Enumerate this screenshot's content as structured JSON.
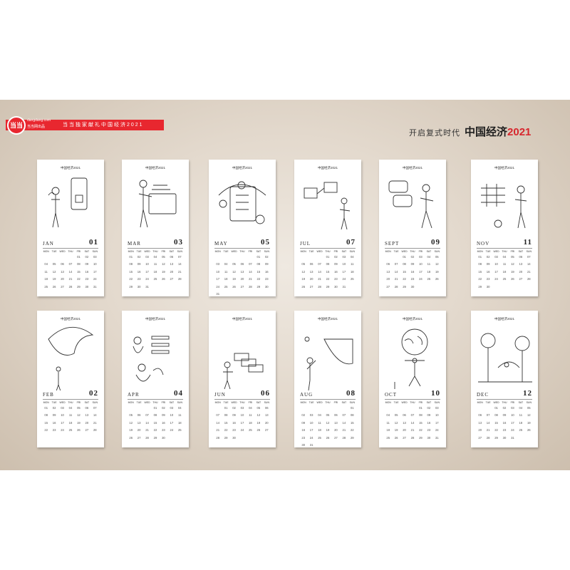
{
  "brand": {
    "logo": "当当",
    "site": "dangdang.com",
    "cn": "当当网出品",
    "slogan": "当当独家献礼中国经济2021"
  },
  "headline": {
    "sub": "开启复式时代",
    "main": "中国经济",
    "year": "2021"
  },
  "card_title": "中国经济2021",
  "weekdays": [
    "MON",
    "TUE",
    "WED",
    "THU",
    "FRI",
    "SAT",
    "SUN"
  ],
  "months": [
    {
      "name": "JAN",
      "num": "01",
      "illustration": "woman-phone-illustration",
      "days": [
        "",
        "",
        "",
        "",
        "01",
        "02",
        "03",
        "04",
        "05",
        "06",
        "07",
        "08",
        "09",
        "10",
        "11",
        "12",
        "13",
        "14",
        "15",
        "16",
        "17",
        "18",
        "19",
        "20",
        "21",
        "22",
        "23",
        "24",
        "25",
        "26",
        "27",
        "28",
        "29",
        "30",
        "31"
      ]
    },
    {
      "name": "MAR",
      "num": "03",
      "illustration": "folder-documents-illustration",
      "days": [
        "01",
        "02",
        "03",
        "04",
        "05",
        "06",
        "07",
        "08",
        "09",
        "10",
        "11",
        "12",
        "13",
        "14",
        "15",
        "16",
        "17",
        "18",
        "19",
        "20",
        "21",
        "22",
        "23",
        "24",
        "25",
        "26",
        "27",
        "28",
        "29",
        "30",
        "31"
      ]
    },
    {
      "name": "MAY",
      "num": "05",
      "illustration": "checklist-clipboard-illustration",
      "days": [
        "",
        "",
        "",
        "",
        "",
        "01",
        "02",
        "03",
        "04",
        "05",
        "06",
        "07",
        "08",
        "09",
        "10",
        "11",
        "12",
        "13",
        "14",
        "15",
        "16",
        "17",
        "18",
        "19",
        "20",
        "21",
        "22",
        "23",
        "24",
        "25",
        "26",
        "27",
        "28",
        "29",
        "30",
        "31"
      ]
    },
    {
      "name": "JUL",
      "num": "07",
      "illustration": "presentation-illustration",
      "days": [
        "",
        "",
        "",
        "01",
        "02",
        "03",
        "04",
        "05",
        "06",
        "07",
        "08",
        "09",
        "10",
        "11",
        "12",
        "13",
        "14",
        "15",
        "16",
        "17",
        "18",
        "19",
        "20",
        "21",
        "22",
        "23",
        "24",
        "25",
        "26",
        "27",
        "28",
        "29",
        "30",
        "31"
      ]
    },
    {
      "name": "SEPT",
      "num": "09",
      "illustration": "chat-bubbles-illustration",
      "days": [
        "",
        "",
        "01",
        "02",
        "03",
        "04",
        "05",
        "06",
        "07",
        "08",
        "09",
        "10",
        "11",
        "12",
        "13",
        "14",
        "15",
        "16",
        "17",
        "18",
        "19",
        "20",
        "21",
        "22",
        "23",
        "24",
        "25",
        "26",
        "27",
        "28",
        "29",
        "30"
      ]
    },
    {
      "name": "NOV",
      "num": "11",
      "illustration": "chart-analyst-illustration",
      "days": [
        "01",
        "02",
        "03",
        "04",
        "05",
        "06",
        "07",
        "08",
        "09",
        "10",
        "11",
        "12",
        "13",
        "14",
        "15",
        "16",
        "17",
        "18",
        "19",
        "20",
        "21",
        "22",
        "23",
        "24",
        "25",
        "26",
        "27",
        "28",
        "29",
        "30"
      ]
    },
    {
      "name": "FEB",
      "num": "02",
      "illustration": "moon-figure-illustration",
      "days": [
        "01",
        "02",
        "03",
        "04",
        "05",
        "06",
        "07",
        "08",
        "09",
        "10",
        "11",
        "12",
        "13",
        "14",
        "15",
        "16",
        "17",
        "18",
        "19",
        "20",
        "21",
        "22",
        "23",
        "24",
        "25",
        "26",
        "27",
        "28"
      ]
    },
    {
      "name": "APR",
      "num": "04",
      "illustration": "team-meeting-illustration",
      "days": [
        "",
        "",
        "",
        "01",
        "02",
        "03",
        "04",
        "05",
        "06",
        "07",
        "08",
        "09",
        "10",
        "11",
        "12",
        "13",
        "14",
        "15",
        "16",
        "17",
        "18",
        "19",
        "20",
        "21",
        "22",
        "23",
        "24",
        "25",
        "26",
        "27",
        "28",
        "29",
        "30"
      ]
    },
    {
      "name": "JUN",
      "num": "06",
      "illustration": "workflow-cards-illustration",
      "days": [
        "",
        "01",
        "02",
        "03",
        "04",
        "05",
        "06",
        "07",
        "08",
        "09",
        "10",
        "11",
        "12",
        "13",
        "14",
        "15",
        "16",
        "17",
        "18",
        "19",
        "20",
        "21",
        "22",
        "23",
        "24",
        "25",
        "26",
        "27",
        "28",
        "29",
        "30"
      ]
    },
    {
      "name": "AUG",
      "num": "08",
      "illustration": "night-sky-illustration",
      "days": [
        "",
        "",
        "",
        "",
        "",
        "",
        "01",
        "02",
        "03",
        "04",
        "05",
        "06",
        "07",
        "08",
        "09",
        "10",
        "11",
        "12",
        "13",
        "14",
        "15",
        "16",
        "17",
        "18",
        "19",
        "20",
        "21",
        "22",
        "23",
        "24",
        "25",
        "26",
        "27",
        "28",
        "29",
        "30",
        "31"
      ]
    },
    {
      "name": "OCT",
      "num": "10",
      "illustration": "globe-carrier-illustration",
      "days": [
        "",
        "",
        "",
        "",
        "01",
        "02",
        "03",
        "04",
        "05",
        "06",
        "07",
        "08",
        "09",
        "10",
        "11",
        "12",
        "13",
        "14",
        "15",
        "16",
        "17",
        "18",
        "19",
        "20",
        "21",
        "22",
        "23",
        "24",
        "25",
        "26",
        "27",
        "28",
        "29",
        "30",
        "31"
      ]
    },
    {
      "name": "DEC",
      "num": "12",
      "illustration": "trees-landscape-illustration",
      "days": [
        "",
        "",
        "01",
        "02",
        "03",
        "04",
        "05",
        "06",
        "07",
        "08",
        "09",
        "10",
        "11",
        "12",
        "13",
        "14",
        "15",
        "16",
        "17",
        "18",
        "19",
        "20",
        "21",
        "22",
        "23",
        "24",
        "25",
        "26",
        "27",
        "28",
        "29",
        "30",
        "31"
      ]
    }
  ]
}
